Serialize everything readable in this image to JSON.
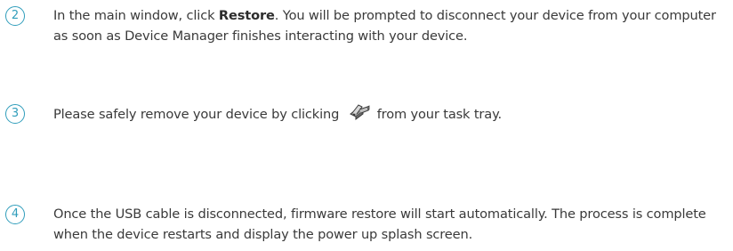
{
  "steps": [
    {
      "number": "2",
      "text_before": "In the main window, click ",
      "bold": "Restore",
      "text_after": ". You will be prompted to disconnect your device from your computer as soon as Device Manager finishes interacting with your device."
    },
    {
      "number": "3",
      "text_before": "Please safely remove your device by clicking ",
      "icon": "safely-remove-hardware-icon",
      "text_after": "from your task tray."
    },
    {
      "number": "4",
      "text": "Once the USB cable is disconnected, firmware restore will start automatically. The process is complete when the device restarts and display the power up splash screen."
    }
  ],
  "colors": {
    "accent": "#2f9dbb",
    "text": "#3a3a3a"
  }
}
